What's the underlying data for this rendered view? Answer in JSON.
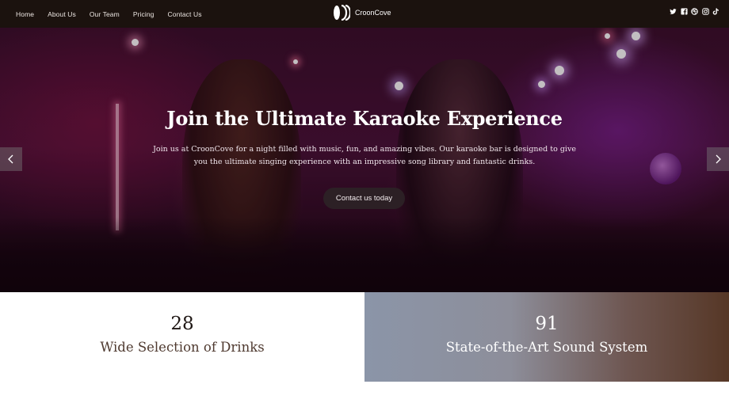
{
  "nav": {
    "links": [
      "Home",
      "About Us",
      "Our Team",
      "Pricing",
      "Contact Us"
    ],
    "brand": "CroonCove",
    "social_icons": [
      "twitter-icon",
      "facebook-icon",
      "dribbble-icon",
      "instagram-icon",
      "tiktok-icon"
    ]
  },
  "hero": {
    "title": "Join the Ultimate Karaoke Experience",
    "body": "Join us at CroonCove for a night filled with music, fun, and amazing vibes. Our karaoke bar is designed to give you the ultimate singing experience with an impressive song library and fantastic drinks.",
    "button_label": "Contact us today",
    "prev_icon": "chevron-left-icon",
    "next_icon": "chevron-right-icon"
  },
  "stats": [
    {
      "number": "28",
      "label": "Wide Selection of Drinks"
    },
    {
      "number": "91",
      "label": "State-of-the-Art Sound System"
    }
  ],
  "colors": {
    "nav_bg": "#1b120e",
    "button_bg": "#2d2326",
    "stat_right_start": "#8b95a8",
    "stat_right_end": "#563726"
  }
}
